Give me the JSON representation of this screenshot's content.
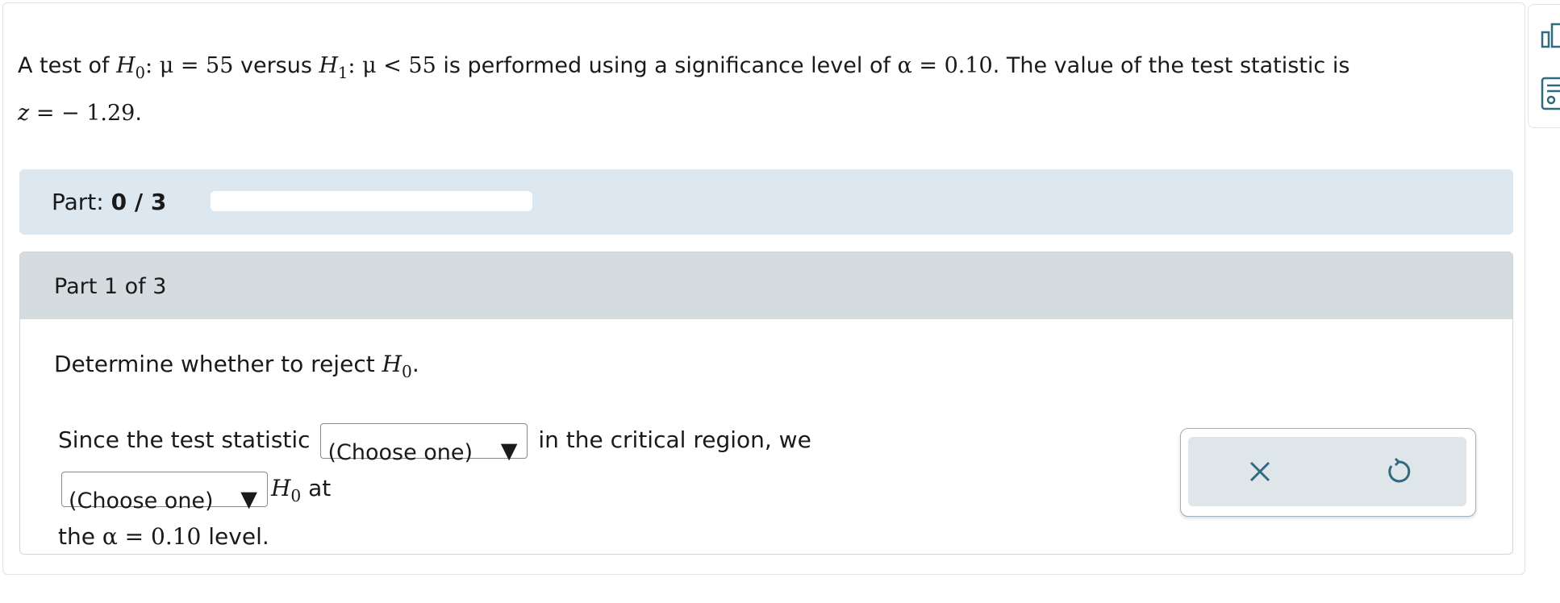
{
  "problem": {
    "prefix": "A test of ",
    "h0_symbol": "H",
    "h0_sub": "0",
    "h0_claim": ": μ = 55",
    "versus": " versus ",
    "h1_symbol": "H",
    "h1_sub": "1",
    "h1_claim": ": μ < 55",
    "middle": " is performed using a significance level of ",
    "alpha_expr": "α = 0.10",
    "suffix": ". The value of the test statistic is",
    "stat_var": "z",
    "stat_value": " = − 1.29",
    "end": "."
  },
  "progress": {
    "label": "Part: ",
    "value": "0 / 3",
    "fraction": 0
  },
  "part": {
    "header": "Part 1 of 3",
    "instruction_text": "Determine whether to reject ",
    "instruction_h": "H",
    "instruction_sub": "0",
    "instruction_end": "."
  },
  "answer": {
    "text1": "Since the test statistic ",
    "select1": "(Choose one)",
    "text2": " in the critical region, we ",
    "select2": "(Choose one)",
    "h_symbol": "H",
    "h_sub": "0",
    "text3": " at",
    "text4": "the ",
    "alpha_expr": "α = 0.10",
    "text5": " level.",
    "arrow": "▼"
  },
  "icons": {
    "tool1": "calculator-icon",
    "tool2": "notes-icon",
    "clear": "close-icon",
    "reset": "undo-icon"
  },
  "colors": {
    "progress_bg": "#dde7f0",
    "part_header_bg": "#d5dcdf",
    "action_bg": "#dfe6ea",
    "icon_color": "#2f6a7f"
  }
}
